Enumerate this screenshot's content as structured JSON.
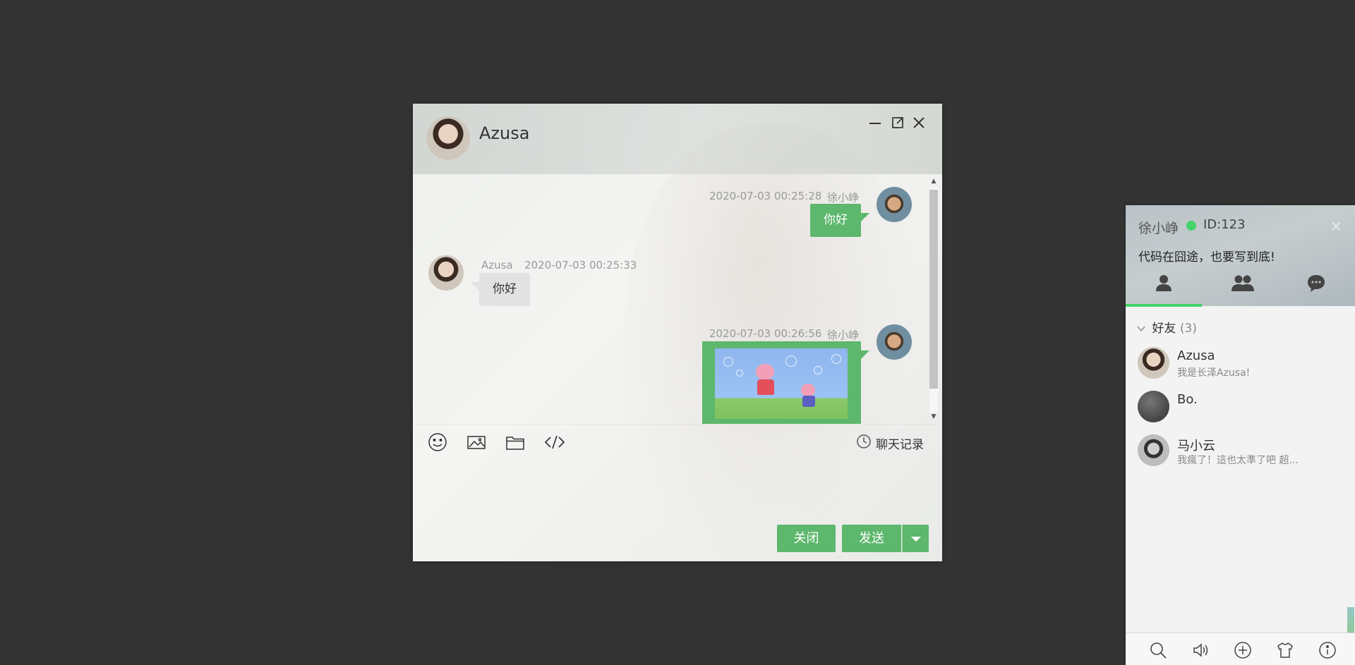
{
  "chat_window": {
    "contact_name": "Azusa",
    "messages": [
      {
        "time": "2020-07-03 00:25:28",
        "sender": "徐小峥",
        "text": "你好"
      },
      {
        "time": "2020-07-03 00:25:33",
        "sender": "Azusa",
        "text": "你好"
      },
      {
        "time": "2020-07-03 00:26:56",
        "sender": "徐小峥",
        "text": ""
      }
    ],
    "toolbar": {
      "emoji_icon": "smiley-icon",
      "image_icon": "image-icon",
      "file_icon": "folder-icon",
      "code_icon": "code-icon",
      "history_label": "聊天记录"
    },
    "buttons": {
      "close_label": "关闭",
      "send_label": "发送"
    }
  },
  "main_panel": {
    "user_name": "徐小峥",
    "user_id": "ID:123",
    "signature": "代码在囧途，也要写到底!",
    "status_color": "#45d36b",
    "group": {
      "name": "好友",
      "count": "(3)"
    },
    "friends": [
      {
        "name": "Azusa",
        "sign": "我是长泽Azusa!"
      },
      {
        "name": "Bo.",
        "sign": ""
      },
      {
        "name": "马小云",
        "sign": "我瘋了！這也太準了吧 超..."
      }
    ]
  },
  "colors": {
    "accent": "#5db76c",
    "online": "#45d36b",
    "background": "#333333"
  }
}
